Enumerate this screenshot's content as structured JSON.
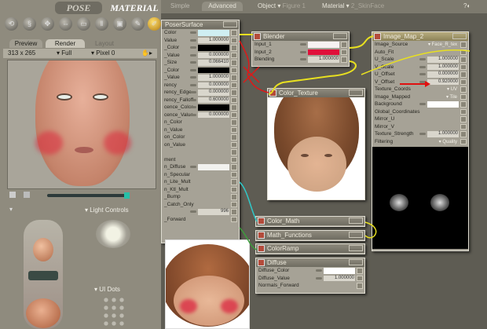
{
  "room_tabs": {
    "pose": "POSE",
    "material": "MATERIAL"
  },
  "preview_panel": {
    "tabs": [
      "Preview",
      "Render",
      "Layout"
    ],
    "size": "313 x 265",
    "mode": "Full",
    "pixel": "Pixel 0"
  },
  "left_labels": {
    "light_controls": "Light Controls",
    "ui_dots": "UI Dots"
  },
  "shader_tabs": {
    "simple": "Simple",
    "advanced": "Advanced"
  },
  "selectors": {
    "object_label": "Object",
    "figure": "Figure 1",
    "material_label": "Material",
    "material": "2_SkinFace"
  },
  "surface_node": {
    "title": "PoserSurface",
    "rows": [
      {
        "label": "Color",
        "swatch": "#cfeef2"
      },
      {
        "label": "Value",
        "value": "1.000000"
      },
      {
        "label": "_Color",
        "swatch": "#000000"
      },
      {
        "label": "_Value",
        "value": "0.000000"
      },
      {
        "label": "_Size",
        "value": "0.066410"
      },
      {
        "label": "_Color",
        "swatch": "#000000"
      },
      {
        "label": "_Value",
        "value": "1.000000"
      },
      {
        "label": "rency",
        "value": "0.000000"
      },
      {
        "label": "rency_Edge",
        "value": "0.000000"
      },
      {
        "label": "rency_Falloff",
        "value": "0.600000"
      },
      {
        "label": "cence_Color",
        "swatch": "#000000"
      },
      {
        "label": "cence_Value",
        "value": "0.000000"
      },
      {
        "label": "n_Color"
      },
      {
        "label": "n_Value"
      },
      {
        "label": "on_Color"
      },
      {
        "label": "on_Value"
      },
      {
        "label": ""
      },
      {
        "label": "ment"
      },
      {
        "label": "n_Diffuse",
        "swatch": "#f2f2ee"
      },
      {
        "label": "n_Specular"
      },
      {
        "label": "n_Lite_Mult"
      },
      {
        "label": "n_Ktl_Mult"
      },
      {
        "label": "_Bump"
      },
      {
        "label": "_Catch_Only"
      },
      {
        "label": "",
        "value": "996"
      },
      {
        "label": "_Forward"
      }
    ]
  },
  "blender_node": {
    "title": "Blender",
    "rows": [
      {
        "label": "Input_1",
        "swatch": "#f6f2f2"
      },
      {
        "label": "Input_2",
        "swatch": "#e0103a"
      },
      {
        "label": "Blending",
        "value": "1.000000"
      }
    ]
  },
  "color_texture_node": {
    "title": "Color_Texture"
  },
  "image_map_node": {
    "title": "Image_Map_2",
    "rows": [
      {
        "label": "Image_Source",
        "dropdown": "Face_R_tex"
      },
      {
        "label": "Auto_Fit"
      },
      {
        "label": "U_Scale",
        "value": "1.000000"
      },
      {
        "label": "V_Scale",
        "value": "1.000000"
      },
      {
        "label": "U_Offset",
        "value": "0.000000"
      },
      {
        "label": "V_Offset",
        "value": "0.920000"
      },
      {
        "label": "Texture_Coords",
        "dropdown": "UV"
      },
      {
        "label": "Image_Mapped",
        "dropdown": "Tile"
      },
      {
        "label": "Background",
        "swatch": "#ffffff"
      },
      {
        "label": "Global_Coordinates"
      },
      {
        "label": "Mirror_U"
      },
      {
        "label": "Mirror_V"
      },
      {
        "label": "Texture_Strength",
        "value": "1.000000"
      },
      {
        "label": "Filtering",
        "dropdown": "Quality"
      }
    ]
  },
  "collapsed_nodes": [
    "Color_Math",
    "Math_Functions",
    "ColorRamp"
  ],
  "diffuse_node": {
    "title": "Diffuse",
    "rows": [
      {
        "label": "Diffuse_Color",
        "swatch": "#ffffff"
      },
      {
        "label": "Diffuse_Value",
        "value": "1.000000"
      },
      {
        "label": "Normals_Forward"
      }
    ]
  },
  "colors": {
    "wire_yellow": "#e8e020",
    "wire_red": "#e01818",
    "wire_cyan": "#30c8c8",
    "annotation_arrow": "#e01010"
  }
}
